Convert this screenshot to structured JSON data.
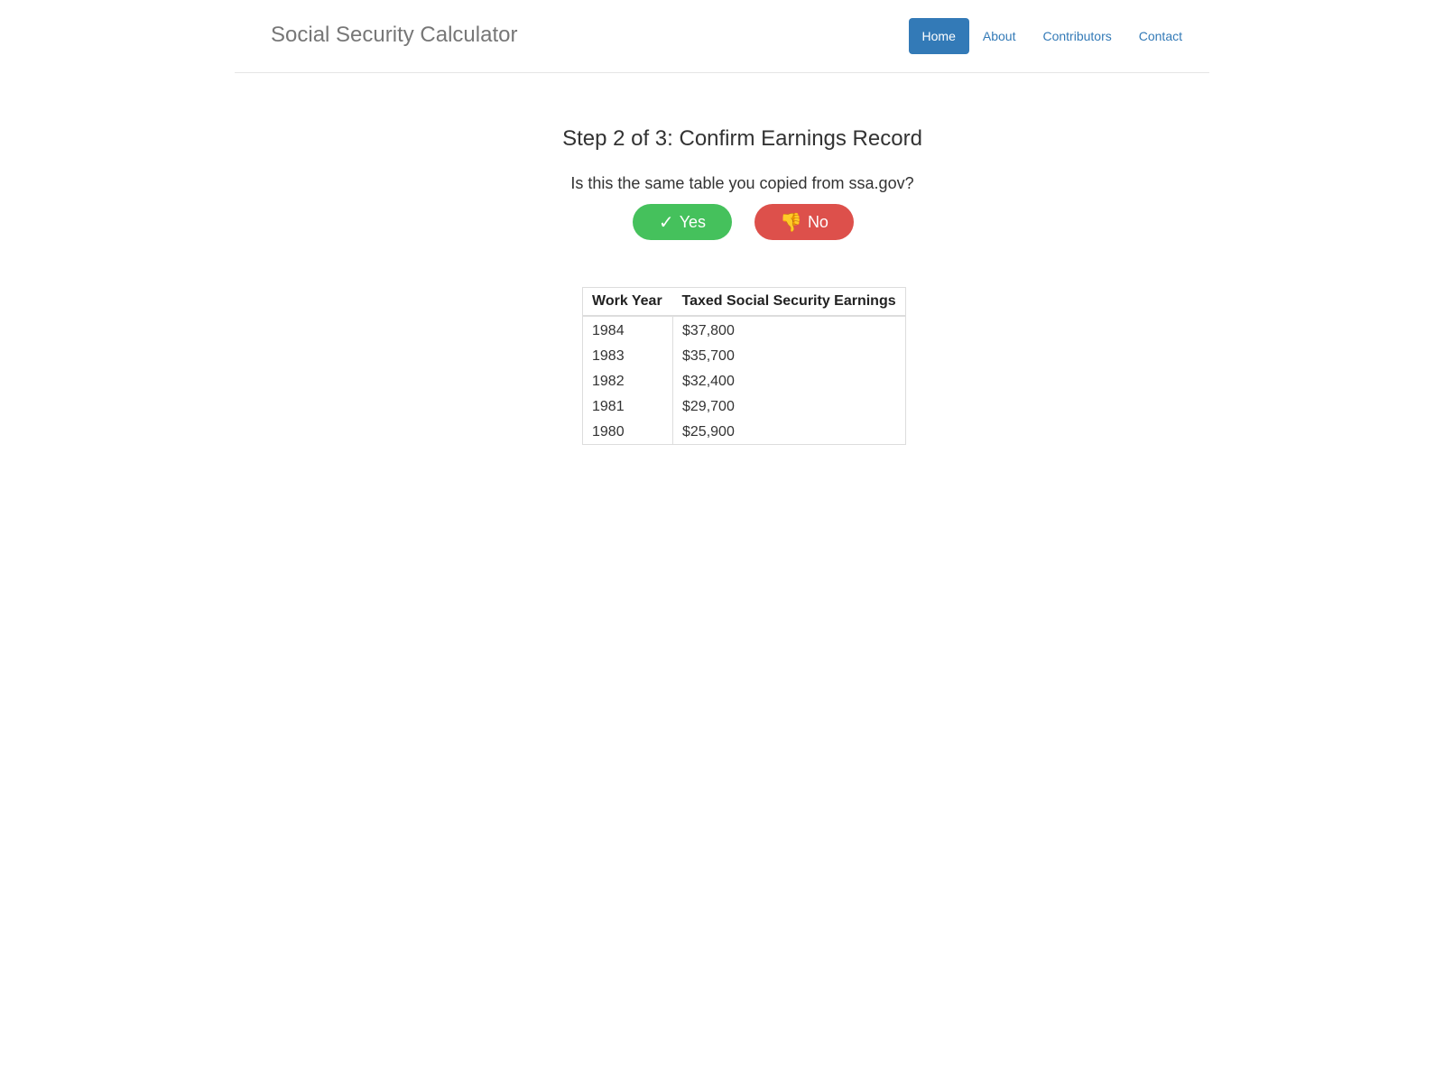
{
  "header": {
    "brand": "Social Security Calculator",
    "nav": [
      {
        "label": "Home",
        "active": true
      },
      {
        "label": "About",
        "active": false
      },
      {
        "label": "Contributors",
        "active": false
      },
      {
        "label": "Contact",
        "active": false
      }
    ]
  },
  "main": {
    "title": "Step 2 of 3: Confirm Earnings Record",
    "question": "Is this the same table you copied from ssa.gov?",
    "yes_button": {
      "icon": "✓",
      "label": "Yes",
      "color": "#45c15c"
    },
    "no_button": {
      "icon": "👎",
      "label": "No",
      "color": "#dd504b"
    }
  },
  "table": {
    "headers": [
      "Work Year",
      "Taxed Social Security Earnings"
    ],
    "rows": [
      [
        "1984",
        "$37,800"
      ],
      [
        "1983",
        "$35,700"
      ],
      [
        "1982",
        "$32,400"
      ],
      [
        "1981",
        "$29,700"
      ],
      [
        "1980",
        "$25,900"
      ]
    ]
  },
  "colors": {
    "accent": "#337ab7",
    "brand_text": "#777777"
  }
}
